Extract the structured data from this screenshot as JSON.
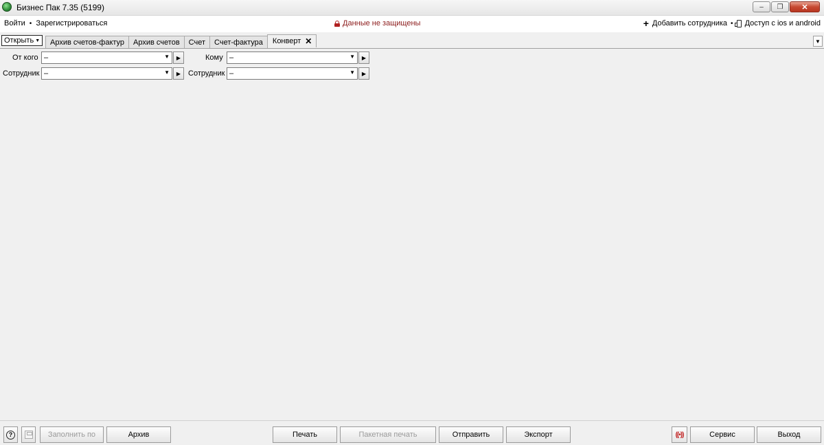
{
  "window": {
    "title": "Бизнес Пак 7.35 (5199)",
    "controls": {
      "minimize": "–",
      "restore": "❐",
      "close": "✕"
    }
  },
  "menu": {
    "login": "Войти",
    "register": "Зарегистрироваться",
    "separator": "•",
    "security_status": "Данные не защищены",
    "add_employee": "Добавить сотрудника",
    "mobile_access": "Доступ с ios и android"
  },
  "tabs": {
    "open_label": "Открыть",
    "items": [
      {
        "label": "Архив счетов-фактур"
      },
      {
        "label": "Архив счетов"
      },
      {
        "label": "Счет"
      },
      {
        "label": "Счет-фактура"
      },
      {
        "label": "Конверт",
        "active": true
      }
    ]
  },
  "form": {
    "from_label": "От кого",
    "from_value": "–",
    "from_employee_label": "Сотрудник",
    "from_employee_value": "–",
    "to_label": "Кому",
    "to_value": "–",
    "to_employee_label": "Сотрудник",
    "to_employee_value": "–"
  },
  "bottom": {
    "fill_from": "Заполнить по",
    "archive": "Архив",
    "print": "Печать",
    "batch_print": "Пакетная печать",
    "send": "Отправить",
    "export": "Экспорт",
    "service": "Сервис",
    "exit": "Выход"
  },
  "colors": {
    "security_text": "#8b1a1a",
    "close_button": "#c74a32"
  }
}
